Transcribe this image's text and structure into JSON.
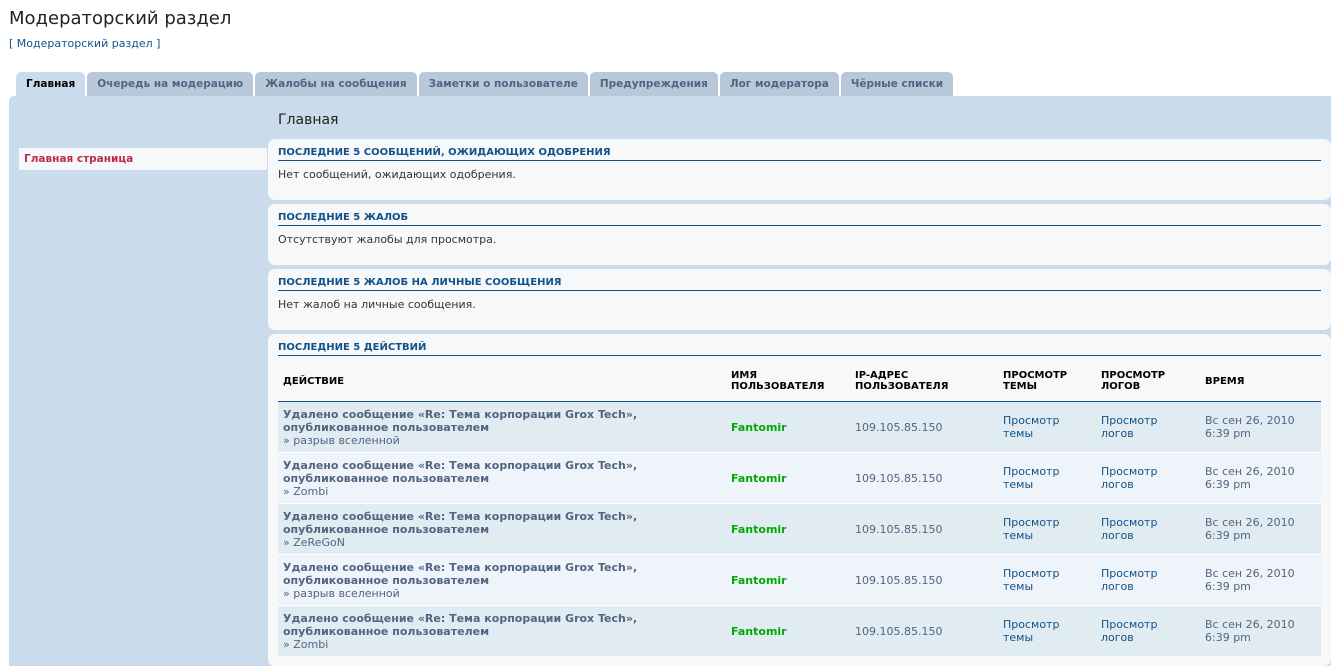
{
  "page": {
    "title": "Модераторский раздел",
    "breadcrumb": "[ Модераторский раздел ]"
  },
  "tabs": [
    {
      "label": "Главная",
      "active": true
    },
    {
      "label": "Очередь на модерацию"
    },
    {
      "label": "Жалобы на сообщения"
    },
    {
      "label": "Заметки о пользователе"
    },
    {
      "label": "Предупреждения"
    },
    {
      "label": "Лог модератора"
    },
    {
      "label": "Чёрные списки"
    }
  ],
  "sidebar": {
    "items": [
      {
        "label": "Главная страница",
        "active": true
      }
    ]
  },
  "main": {
    "title": "Главная",
    "unapproved": {
      "heading": "Последние 5 сообщений, ожидающих одобрения",
      "text": "Нет сообщений, ожидающих одобрения."
    },
    "reports": {
      "heading": "Последние 5 жалоб",
      "text": "Отсутствуют жалобы для просмотра."
    },
    "pm_reports": {
      "heading": "Последние 5 жалоб на личные сообщения",
      "text": "Нет жалоб на личные сообщения."
    },
    "actions": {
      "heading": "Последние 5 действий",
      "columns": {
        "action": "Действие",
        "username_1": "Имя",
        "username_2": "пользователя",
        "ip_1": "IP-адрес",
        "ip_2": "пользователя",
        "topic_1": "Просмотр",
        "topic_2": "темы",
        "logs_1": "Просмотр",
        "logs_2": "логов",
        "time": "Время"
      },
      "rows": [
        {
          "action_1": "Удалено сообщение «Re: Тема корпорации Grox Tech»,",
          "action_2": "опубликованное пользователем",
          "topic": "» разрыв вселенной",
          "username": "Fantomir",
          "ip": "109.105.85.150",
          "view_topic_1": "Просмотр",
          "view_topic_2": "темы",
          "view_logs_1": "Просмотр",
          "view_logs_2": "логов",
          "time_1": "Вс сен 26, 2010",
          "time_2": "6:39 pm"
        },
        {
          "action_1": "Удалено сообщение «Re: Тема корпорации Grox Tech»,",
          "action_2": "опубликованное пользователем",
          "topic": "» Zombi",
          "username": "Fantomir",
          "ip": "109.105.85.150",
          "view_topic_1": "Просмотр",
          "view_topic_2": "темы",
          "view_logs_1": "Просмотр",
          "view_logs_2": "логов",
          "time_1": "Вс сен 26, 2010",
          "time_2": "6:39 pm"
        },
        {
          "action_1": "Удалено сообщение «Re: Тема корпорации Grox Tech»,",
          "action_2": "опубликованное пользователем",
          "topic": "» ZeReGoN",
          "username": "Fantomir",
          "ip": "109.105.85.150",
          "view_topic_1": "Просмотр",
          "view_topic_2": "темы",
          "view_logs_1": "Просмотр",
          "view_logs_2": "логов",
          "time_1": "Вс сен 26, 2010",
          "time_2": "6:39 pm"
        },
        {
          "action_1": "Удалено сообщение «Re: Тема корпорации Grox Tech»,",
          "action_2": "опубликованное пользователем",
          "topic": "» разрыв вселенной",
          "username": "Fantomir",
          "ip": "109.105.85.150",
          "view_topic_1": "Просмотр",
          "view_topic_2": "темы",
          "view_logs_1": "Просмотр",
          "view_logs_2": "логов",
          "time_1": "Вс сен 26, 2010",
          "time_2": "6:39 pm"
        },
        {
          "action_1": "Удалено сообщение «Re: Тема корпорации Grox Tech»,",
          "action_2": "опубликованное пользователем",
          "topic": "» Zombi",
          "username": "Fantomir",
          "ip": "109.105.85.150",
          "view_topic_1": "Просмотр",
          "view_topic_2": "темы",
          "view_logs_1": "Просмотр",
          "view_logs_2": "логов",
          "time_1": "Вс сен 26, 2010",
          "time_2": "6:39 pm"
        }
      ]
    }
  },
  "colors": {
    "panel_bg": "#cadceb",
    "tab_bg": "#b7c8d8",
    "heading": "#105289",
    "username": "#00aa00",
    "sidebar_active": "#bc2a4d"
  }
}
